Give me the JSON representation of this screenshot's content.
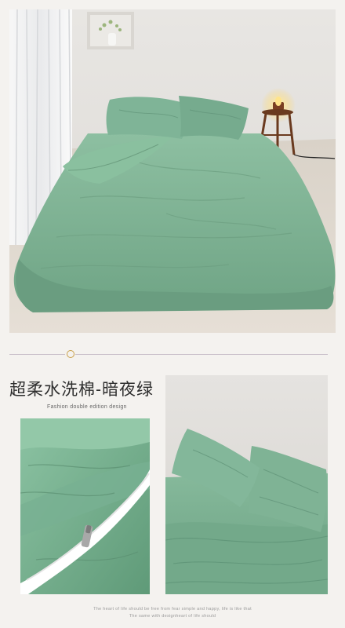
{
  "product": {
    "title": "超柔水洗棉-暗夜绿",
    "subtitle": "Fashion double edition design"
  },
  "footer": {
    "line1": "The heart of life should be free from fear simple and happy, life is like that",
    "line2": "The same with designheart of life should"
  },
  "colors": {
    "bedding_green": "#7fb295",
    "accent_gold": "#c9a04a",
    "background": "#f4f2ef"
  }
}
